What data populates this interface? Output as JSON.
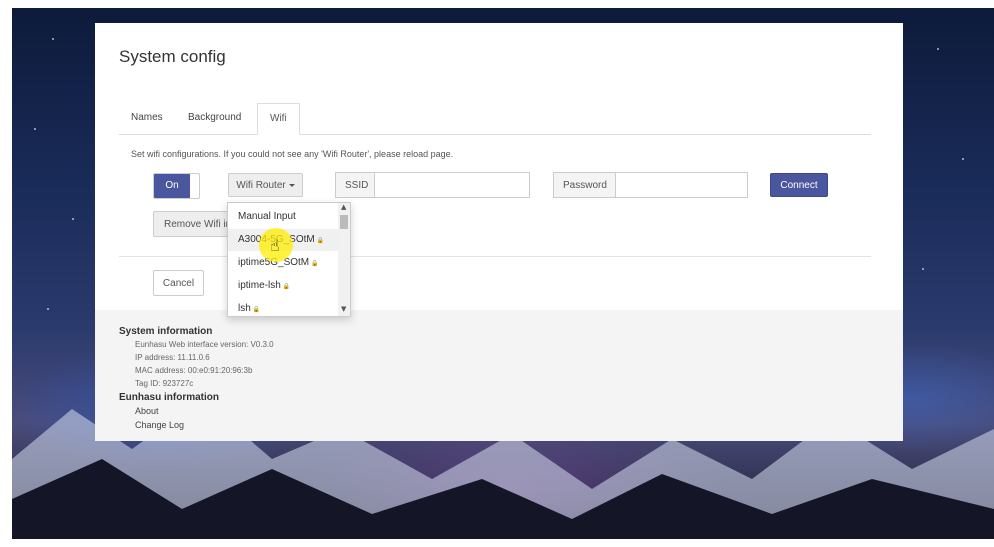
{
  "page": {
    "title": "System config"
  },
  "tabs": [
    {
      "label": "Names",
      "active": false
    },
    {
      "label": "Background",
      "active": false
    },
    {
      "label": "Wifi",
      "active": true
    }
  ],
  "wifi": {
    "hint": "Set wifi configurations. If you could not see any 'Wifi Router', please reload page.",
    "toggle_label": "On",
    "router_button_label": "Wifi Router",
    "ssid_label": "SSID",
    "ssid_value": "",
    "password_label": "Password",
    "password_value": "",
    "connect_label": "Connect",
    "remove_label": "Remove Wifi in",
    "cancel_label": "Cancel"
  },
  "router_dropdown": {
    "items": [
      {
        "label": "Manual Input",
        "secured": false
      },
      {
        "label": "A3004-5G_SOtM",
        "secured": true
      },
      {
        "label": "iptime5G_SOtM",
        "secured": true
      },
      {
        "label": "iptime-lsh",
        "secured": true
      },
      {
        "label": "lsh",
        "secured": true
      }
    ]
  },
  "system_information": {
    "title": "System information",
    "lines": [
      "Eunhasu Web interface version: V0.3.0",
      "IP address: 11.11.0.6",
      "MAC address: 00:e0:91:20:96:3b",
      "Tag ID: 923727c"
    ]
  },
  "eunhasu_information": {
    "title": "Eunhasu information",
    "links": [
      "About",
      "Change Log"
    ]
  },
  "colors": {
    "accent": "#4a569d"
  }
}
